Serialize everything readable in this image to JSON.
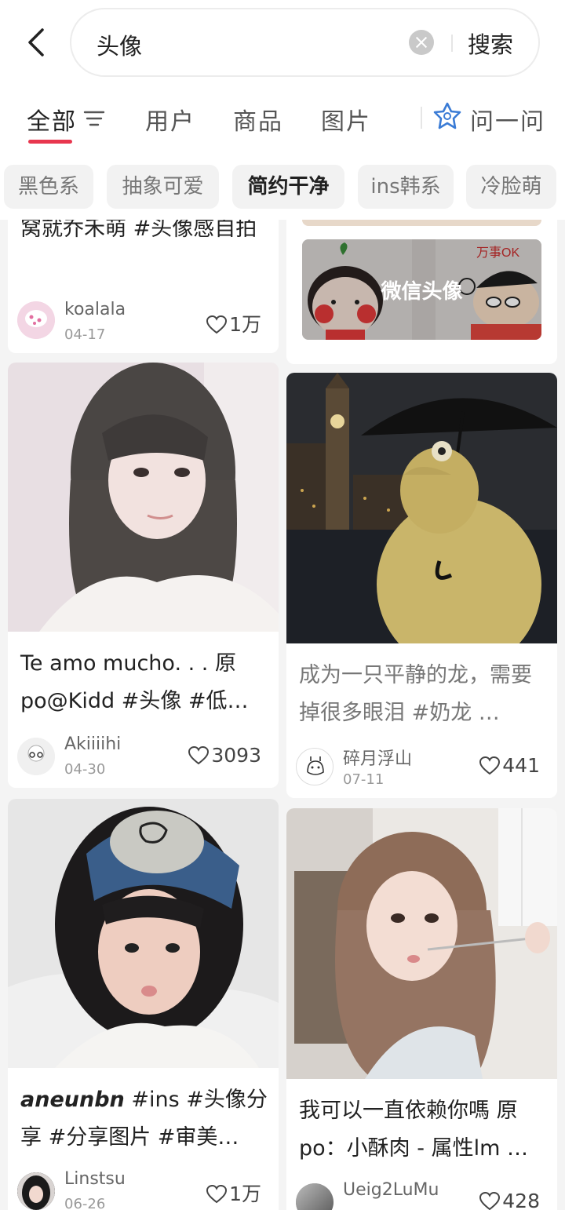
{
  "search": {
    "query": "头像",
    "button": "搜索"
  },
  "tabs": [
    {
      "label": "全部"
    },
    {
      "label": "用户"
    },
    {
      "label": "商品"
    },
    {
      "label": "图片"
    },
    {
      "label": "问一问"
    }
  ],
  "chips": [
    "黑色系",
    "抽象可爱",
    "简约干净",
    "ins韩系",
    "冷脸萌"
  ],
  "colors": {
    "accent": "#e8364e",
    "chip_bg": "#f2f2f2",
    "ask_icon": "#3a7bd5"
  },
  "feed": {
    "left": [
      {
        "caption": "窝就乔禾萌 #头像感自拍",
        "author": "koalala",
        "date": "04-17",
        "likes": "1万"
      },
      {
        "caption": "Te amo mucho. . . 原po@Kidd #头像  #低…",
        "author": "Akiiiihi",
        "date": "04-30",
        "likes": "3093"
      },
      {
        "caption_bold": "aneunbn",
        "caption": " #ins  #头像分享  #分享图片  #审美…",
        "author": "Linstsu",
        "date": "06-26",
        "likes": "1万"
      }
    ],
    "right": [
      {
        "image_label": "微信头像",
        "sticker_text": "万事OK"
      },
      {
        "caption": "成为一只平静的龙，需要掉很多眼泪 #奶龙 …",
        "author": "碎月浮山",
        "date": "07-11",
        "likes": "441"
      },
      {
        "caption": "我可以一直依赖你嗎 原po：小酥肉 - 属性lm …",
        "author": "Ueig2LuMu",
        "likes": "428"
      }
    ]
  }
}
